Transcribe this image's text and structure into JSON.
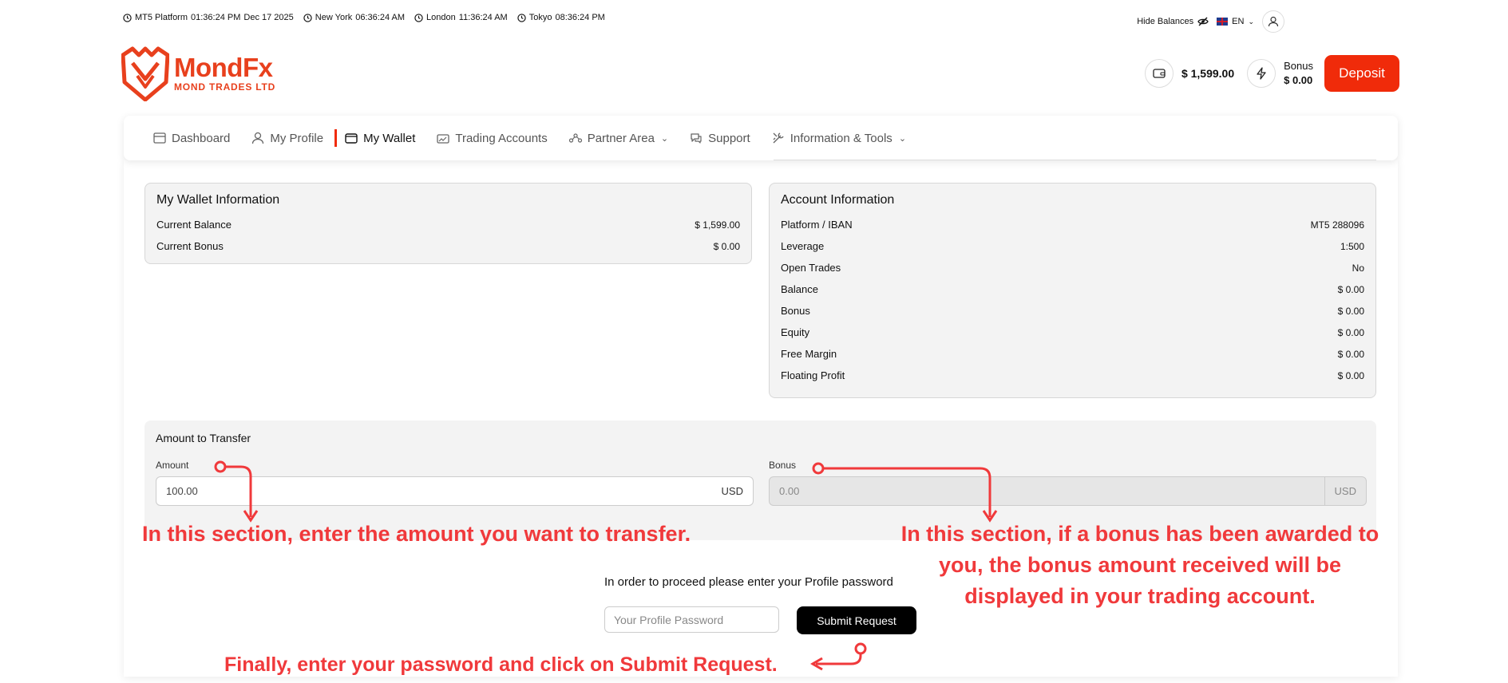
{
  "clocks": [
    {
      "label": "MT5 Platform",
      "time": "01:36:24 PM",
      "date": "Dec 17 2025"
    },
    {
      "label": "New York",
      "time": "06:36:24 AM"
    },
    {
      "label": "London",
      "time": "11:36:24 AM"
    },
    {
      "label": "Tokyo",
      "time": "08:36:24 PM"
    }
  ],
  "topbar": {
    "hide_balances": "Hide Balances",
    "language": "EN"
  },
  "logo": {
    "name": "MondFx",
    "subtitle": "MOND TRADES LTD"
  },
  "header": {
    "wallet_balance": "$ 1,599.00",
    "bonus_label": "Bonus",
    "bonus_value": "$ 0.00",
    "deposit": "Deposit"
  },
  "nav": {
    "items": [
      {
        "label": "Dashboard",
        "icon": "dashboard-icon"
      },
      {
        "label": "My Profile",
        "icon": "user-icon"
      },
      {
        "label": "My Wallet",
        "icon": "wallet-icon",
        "active": true
      },
      {
        "label": "Trading Accounts",
        "icon": "trading-icon"
      },
      {
        "label": "Partner Area",
        "icon": "network-icon",
        "dropdown": true
      },
      {
        "label": "Support",
        "icon": "chat-icon"
      },
      {
        "label": "Information & Tools",
        "icon": "tools-icon",
        "dropdown": true
      }
    ]
  },
  "wallet_info": {
    "title": "My Wallet Information",
    "rows": [
      {
        "label": "Current Balance",
        "value": "$ 1,599.00"
      },
      {
        "label": "Current Bonus",
        "value": "$ 0.00"
      }
    ]
  },
  "account_info": {
    "title": "Account Information",
    "rows": [
      {
        "label": "Platform / IBAN",
        "value": "MT5 288096"
      },
      {
        "label": "Leverage",
        "value": "1:500"
      },
      {
        "label": "Open Trades",
        "value": "No"
      },
      {
        "label": "Balance",
        "value": "$ 0.00"
      },
      {
        "label": "Bonus",
        "value": "$ 0.00"
      },
      {
        "label": "Equity",
        "value": "$ 0.00"
      },
      {
        "label": "Free Margin",
        "value": "$ 0.00"
      },
      {
        "label": "Floating Profit",
        "value": "$ 0.00"
      }
    ]
  },
  "transfer": {
    "title": "Amount to Transfer",
    "amount_label": "Amount",
    "amount_value": "100.00",
    "amount_currency": "USD",
    "bonus_label": "Bonus",
    "bonus_value": "0.00",
    "bonus_currency": "USD"
  },
  "password": {
    "prompt": "In order to proceed please enter your Profile password",
    "placeholder": "Your Profile Password",
    "submit": "Submit Request"
  },
  "annotations": {
    "amount": "In this section, enter the amount you want to transfer.",
    "bonus_line1": "In this section, if a bonus has been awarded to",
    "bonus_line2": "you, the bonus amount received will be",
    "bonus_line3": "displayed in your trading account.",
    "submit": "Finally, enter your password and click on Submit Request.",
    "color": "#f0393b"
  },
  "colors": {
    "brand": "#e8401d",
    "deposit": "#f02b0a",
    "submit": "#000000"
  }
}
